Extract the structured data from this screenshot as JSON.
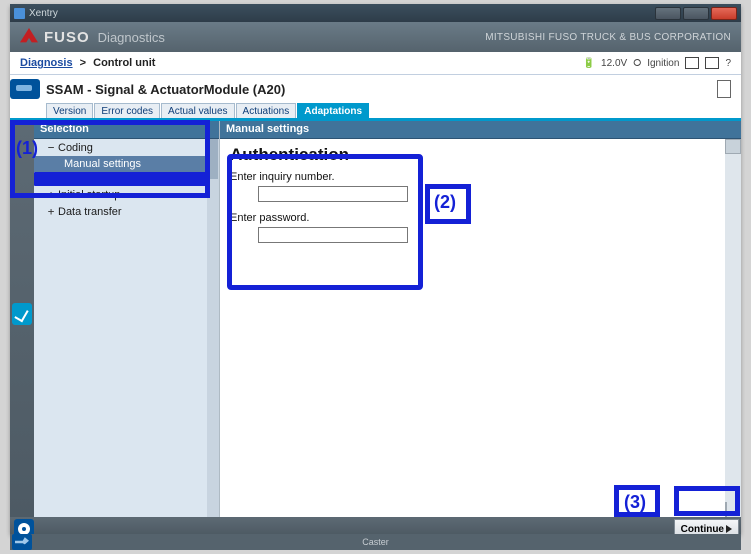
{
  "titlebar": {
    "app": "Xentry"
  },
  "header": {
    "brand": "FUSO",
    "section": "Diagnostics",
    "corp": "MITSUBISHI FUSO TRUCK & BUS CORPORATION"
  },
  "breadcrumb": {
    "link": "Diagnosis",
    "current": "Control unit"
  },
  "status": {
    "voltage": "12.0V",
    "ignition": "Ignition"
  },
  "module": {
    "title": "SSAM - Signal & ActuatorModule (A20)"
  },
  "tabs": {
    "t0": "Version",
    "t1": "Error codes",
    "t2": "Actual values",
    "t3": "Actuations",
    "t4": "Adaptations"
  },
  "selection": {
    "header": "Selection",
    "coding": "Coding",
    "manual_settings": "Manual settings",
    "initial_startup": "Initial startup",
    "data_transfer": "Data transfer"
  },
  "panel": {
    "header": "Manual settings",
    "title": "Authentication",
    "inquiry_label": "Enter inquiry number.",
    "password_label": "Enter password."
  },
  "buttons": {
    "continue": "Continue"
  },
  "footer": {
    "text": "Caster"
  },
  "annotations": {
    "a1": "(1)",
    "a2": "(2)",
    "a3": "(3)"
  },
  "chart_data": null
}
